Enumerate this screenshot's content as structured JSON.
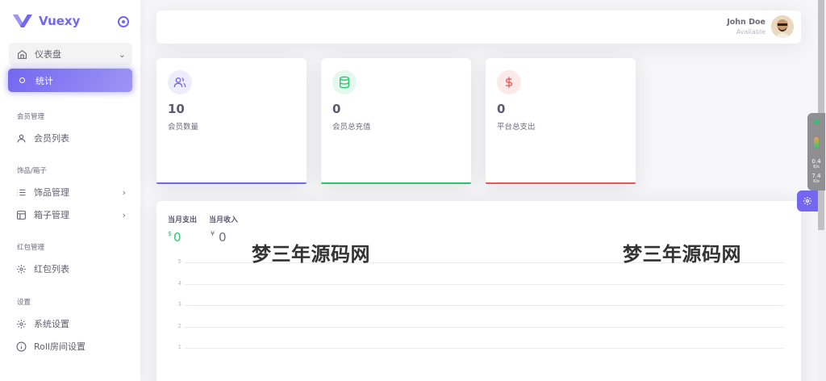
{
  "brand": {
    "name": "Vuexy"
  },
  "sidebar": {
    "dashboard": {
      "label": "仪表盘"
    },
    "active": {
      "label": "统计"
    },
    "sections": [
      {
        "label": "会员管理"
      },
      {
        "label": "饰品/箱子"
      },
      {
        "label": "红包管理"
      },
      {
        "label": "设置"
      }
    ],
    "items": [
      {
        "label": "会员列表",
        "icon": "user-icon"
      },
      {
        "label": "饰品管理",
        "icon": "list-icon"
      },
      {
        "label": "箱子管理",
        "icon": "layout-icon"
      },
      {
        "label": "红包列表",
        "icon": "settings-icon"
      },
      {
        "label": "系统设置",
        "icon": "settings-icon"
      },
      {
        "label": "Roll房间设置",
        "icon": "info-icon"
      }
    ]
  },
  "navbar": {
    "user_name": "John Doe",
    "user_status": "Available"
  },
  "stats": [
    {
      "value": "10",
      "label": "会员数量",
      "icon": "users-icon",
      "color": "#7367f0"
    },
    {
      "value": "0",
      "label": "会员总充值",
      "icon": "database-icon",
      "color": "#28c76f"
    },
    {
      "value": "0",
      "label": "平台总支出",
      "icon": "dollar-icon",
      "color": "#ea5455"
    }
  ],
  "chart_card": {
    "expense_title": "当月支出",
    "expense_currency": "$",
    "expense_value": "0",
    "income_title": "当月收入",
    "income_currency": "¥",
    "income_value": "0"
  },
  "chart_data": {
    "type": "line",
    "title": "",
    "yticks": [
      "5",
      "4",
      "3",
      "2",
      "1"
    ]
  },
  "watermark": {
    "text": "梦三年源码网"
  },
  "monitor": {
    "value1": "0.4",
    "unit1": "K/s",
    "value2": "7.4",
    "unit2": "K/s"
  },
  "colors": {
    "primary": "#7367f0",
    "success": "#28c76f",
    "danger": "#ea5455"
  }
}
